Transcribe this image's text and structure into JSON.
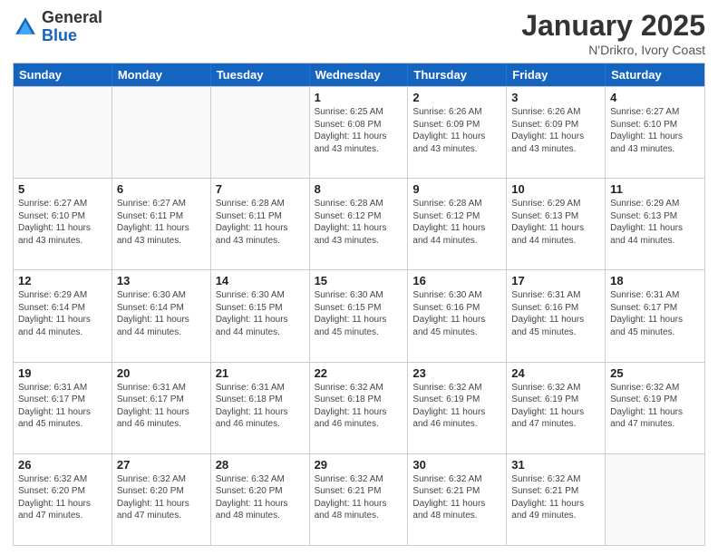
{
  "header": {
    "logo_general": "General",
    "logo_blue": "Blue",
    "month_title": "January 2025",
    "location": "N'Drikro, Ivory Coast"
  },
  "weekdays": [
    "Sunday",
    "Monday",
    "Tuesday",
    "Wednesday",
    "Thursday",
    "Friday",
    "Saturday"
  ],
  "rows": [
    [
      {
        "day": "",
        "info": ""
      },
      {
        "day": "",
        "info": ""
      },
      {
        "day": "",
        "info": ""
      },
      {
        "day": "1",
        "info": "Sunrise: 6:25 AM\nSunset: 6:08 PM\nDaylight: 11 hours\nand 43 minutes."
      },
      {
        "day": "2",
        "info": "Sunrise: 6:26 AM\nSunset: 6:09 PM\nDaylight: 11 hours\nand 43 minutes."
      },
      {
        "day": "3",
        "info": "Sunrise: 6:26 AM\nSunset: 6:09 PM\nDaylight: 11 hours\nand 43 minutes."
      },
      {
        "day": "4",
        "info": "Sunrise: 6:27 AM\nSunset: 6:10 PM\nDaylight: 11 hours\nand 43 minutes."
      }
    ],
    [
      {
        "day": "5",
        "info": "Sunrise: 6:27 AM\nSunset: 6:10 PM\nDaylight: 11 hours\nand 43 minutes."
      },
      {
        "day": "6",
        "info": "Sunrise: 6:27 AM\nSunset: 6:11 PM\nDaylight: 11 hours\nand 43 minutes."
      },
      {
        "day": "7",
        "info": "Sunrise: 6:28 AM\nSunset: 6:11 PM\nDaylight: 11 hours\nand 43 minutes."
      },
      {
        "day": "8",
        "info": "Sunrise: 6:28 AM\nSunset: 6:12 PM\nDaylight: 11 hours\nand 43 minutes."
      },
      {
        "day": "9",
        "info": "Sunrise: 6:28 AM\nSunset: 6:12 PM\nDaylight: 11 hours\nand 44 minutes."
      },
      {
        "day": "10",
        "info": "Sunrise: 6:29 AM\nSunset: 6:13 PM\nDaylight: 11 hours\nand 44 minutes."
      },
      {
        "day": "11",
        "info": "Sunrise: 6:29 AM\nSunset: 6:13 PM\nDaylight: 11 hours\nand 44 minutes."
      }
    ],
    [
      {
        "day": "12",
        "info": "Sunrise: 6:29 AM\nSunset: 6:14 PM\nDaylight: 11 hours\nand 44 minutes."
      },
      {
        "day": "13",
        "info": "Sunrise: 6:30 AM\nSunset: 6:14 PM\nDaylight: 11 hours\nand 44 minutes."
      },
      {
        "day": "14",
        "info": "Sunrise: 6:30 AM\nSunset: 6:15 PM\nDaylight: 11 hours\nand 44 minutes."
      },
      {
        "day": "15",
        "info": "Sunrise: 6:30 AM\nSunset: 6:15 PM\nDaylight: 11 hours\nand 45 minutes."
      },
      {
        "day": "16",
        "info": "Sunrise: 6:30 AM\nSunset: 6:16 PM\nDaylight: 11 hours\nand 45 minutes."
      },
      {
        "day": "17",
        "info": "Sunrise: 6:31 AM\nSunset: 6:16 PM\nDaylight: 11 hours\nand 45 minutes."
      },
      {
        "day": "18",
        "info": "Sunrise: 6:31 AM\nSunset: 6:17 PM\nDaylight: 11 hours\nand 45 minutes."
      }
    ],
    [
      {
        "day": "19",
        "info": "Sunrise: 6:31 AM\nSunset: 6:17 PM\nDaylight: 11 hours\nand 45 minutes."
      },
      {
        "day": "20",
        "info": "Sunrise: 6:31 AM\nSunset: 6:17 PM\nDaylight: 11 hours\nand 46 minutes."
      },
      {
        "day": "21",
        "info": "Sunrise: 6:31 AM\nSunset: 6:18 PM\nDaylight: 11 hours\nand 46 minutes."
      },
      {
        "day": "22",
        "info": "Sunrise: 6:32 AM\nSunset: 6:18 PM\nDaylight: 11 hours\nand 46 minutes."
      },
      {
        "day": "23",
        "info": "Sunrise: 6:32 AM\nSunset: 6:19 PM\nDaylight: 11 hours\nand 46 minutes."
      },
      {
        "day": "24",
        "info": "Sunrise: 6:32 AM\nSunset: 6:19 PM\nDaylight: 11 hours\nand 47 minutes."
      },
      {
        "day": "25",
        "info": "Sunrise: 6:32 AM\nSunset: 6:19 PM\nDaylight: 11 hours\nand 47 minutes."
      }
    ],
    [
      {
        "day": "26",
        "info": "Sunrise: 6:32 AM\nSunset: 6:20 PM\nDaylight: 11 hours\nand 47 minutes."
      },
      {
        "day": "27",
        "info": "Sunrise: 6:32 AM\nSunset: 6:20 PM\nDaylight: 11 hours\nand 47 minutes."
      },
      {
        "day": "28",
        "info": "Sunrise: 6:32 AM\nSunset: 6:20 PM\nDaylight: 11 hours\nand 48 minutes."
      },
      {
        "day": "29",
        "info": "Sunrise: 6:32 AM\nSunset: 6:21 PM\nDaylight: 11 hours\nand 48 minutes."
      },
      {
        "day": "30",
        "info": "Sunrise: 6:32 AM\nSunset: 6:21 PM\nDaylight: 11 hours\nand 48 minutes."
      },
      {
        "day": "31",
        "info": "Sunrise: 6:32 AM\nSunset: 6:21 PM\nDaylight: 11 hours\nand 49 minutes."
      },
      {
        "day": "",
        "info": ""
      }
    ]
  ]
}
